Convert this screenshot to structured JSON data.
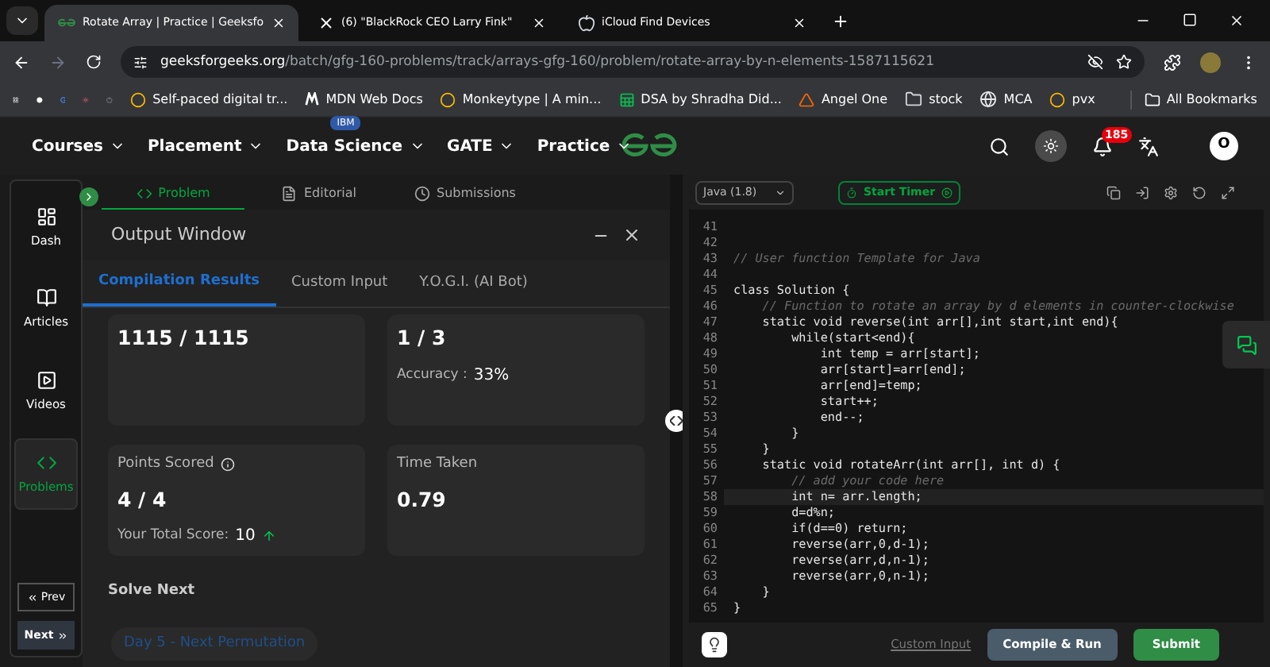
{
  "browser": {
    "tabs": [
      {
        "title": "Rotate Array | Practice | Geeksfo",
        "selected": true,
        "kind": "gfg"
      },
      {
        "title": "(6) \"BlackRock CEO Larry Fink\"",
        "selected": false,
        "kind": "x"
      },
      {
        "title": "iCloud Find Devices",
        "selected": false,
        "kind": "apple"
      }
    ],
    "url": {
      "domain": "geeksforgeeks.org",
      "path": "/batch/gfg-160-problems/track/arrays-gfg-160/problem/rotate-array-by-n-elements-1587115621"
    },
    "bookmarks": [
      {
        "label": "Self-paced digital tr...",
        "kind": "site"
      },
      {
        "label": "MDN Web Docs",
        "kind": "mdn"
      },
      {
        "label": "Monkeytype | A min...",
        "kind": "site"
      },
      {
        "label": "DSA by Shradha Did...",
        "kind": "sheet"
      },
      {
        "label": "Angel One",
        "kind": "angel"
      },
      {
        "label": "stock",
        "kind": "folder"
      },
      {
        "label": "MCA",
        "kind": "globe"
      },
      {
        "label": "pvx",
        "kind": "site"
      }
    ],
    "all_bookmarks": "All Bookmarks"
  },
  "site_nav": {
    "items": [
      {
        "label": "Courses"
      },
      {
        "label": "Placement"
      },
      {
        "label": "Data Science",
        "badge": "IBM"
      },
      {
        "label": "GATE"
      },
      {
        "label": "Practice"
      }
    ],
    "notification_count": "185",
    "avatar": "O"
  },
  "sidebar": {
    "items": [
      {
        "label": "Dash",
        "kind": "dash",
        "selected": false
      },
      {
        "label": "Articles",
        "kind": "articles",
        "selected": false
      },
      {
        "label": "Videos",
        "kind": "videos",
        "selected": false
      },
      {
        "label": "Problems",
        "kind": "problems",
        "selected": true
      }
    ],
    "prev": "Prev",
    "next": "Next"
  },
  "problem_tabs": [
    {
      "label": "Problem",
      "kind": "problem",
      "selected": true
    },
    {
      "label": "Editorial",
      "kind": "editorial",
      "selected": false
    },
    {
      "label": "Submissions",
      "kind": "submissions",
      "selected": false
    }
  ],
  "output_window": {
    "title": "Output Window",
    "tabs": [
      {
        "label": "Compilation Results",
        "selected": true
      },
      {
        "label": "Custom Input",
        "selected": false
      },
      {
        "label": "Y.O.G.I. (AI Bot)",
        "selected": false
      }
    ],
    "cards": [
      {
        "kind": "plain",
        "value": "1115 / 1115"
      },
      {
        "kind": "accuracy",
        "value": "1 / 3",
        "sub_label": "Accuracy :",
        "sub_value": "33%"
      },
      {
        "kind": "score",
        "title": "Points Scored",
        "value": "4 / 4",
        "sub_label": "Your Total Score:",
        "sub_value": "10"
      },
      {
        "kind": "plain",
        "title": "Time Taken",
        "value": "0.79"
      }
    ],
    "solve_next": {
      "heading": "Solve Next",
      "item": "Day 5 - Next Permutation"
    }
  },
  "editor": {
    "language": "Java (1.8)",
    "timer": "Start Timer",
    "lines": [
      {
        "number": "41",
        "selected": false
      },
      {
        "number": "42",
        "selected": false
      },
      {
        "number": "43",
        "text": "// User function Template for Java",
        "kind": "comment",
        "selected": false
      },
      {
        "number": "44",
        "selected": false
      },
      {
        "number": "45",
        "text": "class Solution {",
        "kind": "code",
        "selected": false
      },
      {
        "number": "46",
        "text": "    // Function to rotate an array by d elements in counter-clockwise",
        "kind": "comment",
        "selected": false
      },
      {
        "number": "47",
        "text": "    static void reverse(int arr[],int start,int end){",
        "kind": "code",
        "selected": false
      },
      {
        "number": "48",
        "text": "        while(start<end){",
        "kind": "code",
        "selected": false
      },
      {
        "number": "49",
        "text": "            int temp = arr[start];",
        "kind": "code",
        "selected": false
      },
      {
        "number": "50",
        "text": "            arr[start]=arr[end];",
        "kind": "code",
        "selected": false
      },
      {
        "number": "51",
        "text": "            arr[end]=temp;",
        "kind": "code",
        "selected": false
      },
      {
        "number": "52",
        "text": "            start++;",
        "kind": "code",
        "selected": false
      },
      {
        "number": "53",
        "text": "            end--;",
        "kind": "code",
        "selected": false
      },
      {
        "number": "54",
        "text": "        }",
        "kind": "code",
        "selected": false
      },
      {
        "number": "55",
        "text": "    }",
        "kind": "code",
        "selected": false
      },
      {
        "number": "56",
        "text": "    static void rotateArr(int arr[], int d) {",
        "kind": "code",
        "selected": false
      },
      {
        "number": "57",
        "text": "        // add your code here",
        "kind": "comment",
        "selected": false
      },
      {
        "number": "58",
        "text": "        int n= arr.length;",
        "kind": "code",
        "selected": true
      },
      {
        "number": "59",
        "text": "        d=d%n;",
        "kind": "code",
        "selected": false
      },
      {
        "number": "60",
        "text": "        if(d==0) return;",
        "kind": "code",
        "selected": false
      },
      {
        "number": "61",
        "text": "        reverse(arr,0,d-1);",
        "kind": "code",
        "selected": false
      },
      {
        "number": "62",
        "text": "        reverse(arr,d,n-1);",
        "kind": "code",
        "selected": false
      },
      {
        "number": "63",
        "text": "        reverse(arr,0,n-1);",
        "kind": "code",
        "selected": false
      },
      {
        "number": "64",
        "text": "    }",
        "kind": "code",
        "selected": false
      },
      {
        "number": "65",
        "text": "}",
        "kind": "code",
        "selected": false
      }
    ],
    "custom_input": "Custom Input",
    "compile": "Compile & Run",
    "submit": "Submit"
  }
}
